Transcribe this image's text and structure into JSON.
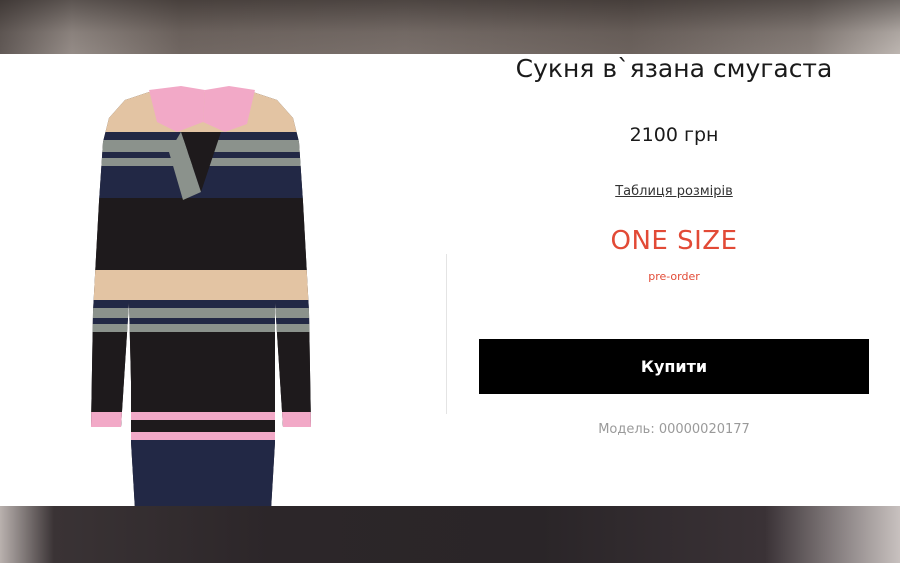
{
  "product": {
    "title": "Сукня в`язана смугаста",
    "price": "2100 грн",
    "size_table_link": "Таблиця розмірів",
    "size": "ONE SIZE",
    "availability": "pre-order",
    "buy_label": "Купити",
    "model": "Модель: 00000020177"
  },
  "image": {
    "icon": "striped-knit-dress",
    "colors": {
      "pink": "#f2a9c7",
      "beige": "#e3c4a3",
      "gray": "#8b928c",
      "navy": "#222845",
      "black": "#1e1a1c"
    }
  },
  "accent_color": "#e24a36"
}
